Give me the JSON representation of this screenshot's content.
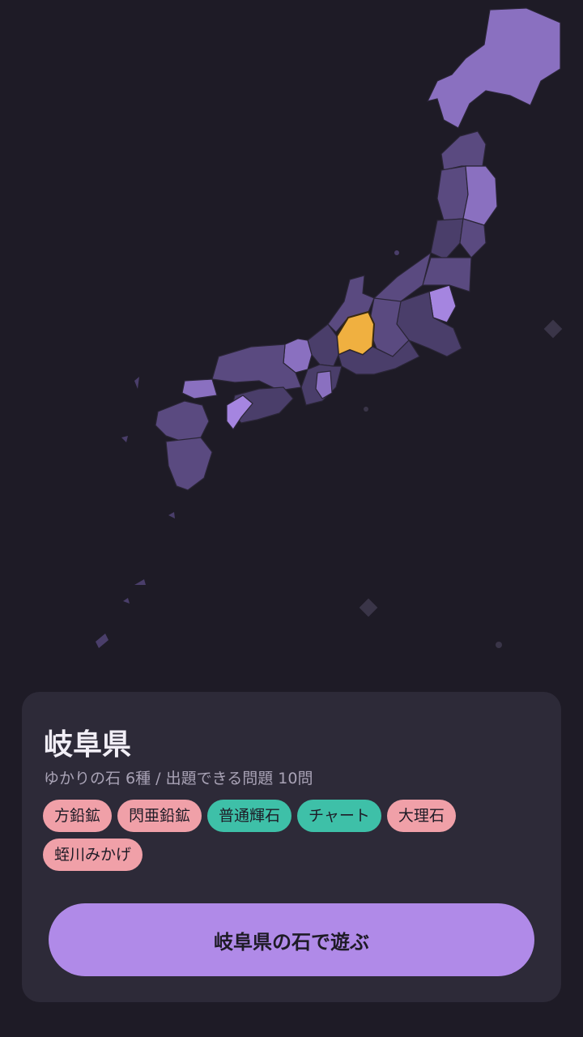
{
  "map": {
    "colors": {
      "background": "#1e1b26",
      "region_default": "#5a4a80",
      "region_dim": "#4a3e6a",
      "region_highlight": "#8a70c0",
      "region_bright": "#a585e0",
      "region_selected": "#f0b040",
      "island": "#3a3548"
    },
    "selected_prefecture": "岐阜県"
  },
  "detail": {
    "prefecture": "岐阜県",
    "summary": "ゆかりの石 6種 / 出題できる問題 10問",
    "stones": [
      {
        "name": "方鉛鉱",
        "color": "#f0a0a8"
      },
      {
        "name": "閃亜鉛鉱",
        "color": "#f0a0a8"
      },
      {
        "name": "普通輝石",
        "color": "#3ec0a8"
      },
      {
        "name": "チャート",
        "color": "#3ec0a8"
      },
      {
        "name": "大理石",
        "color": "#f0a0a8"
      },
      {
        "name": "蛭川みかげ",
        "color": "#f0a0a8"
      }
    ],
    "play_button": "岐阜県の石で遊ぶ",
    "play_button_color": "#b08ae8",
    "card_color": "#2d2a38"
  }
}
